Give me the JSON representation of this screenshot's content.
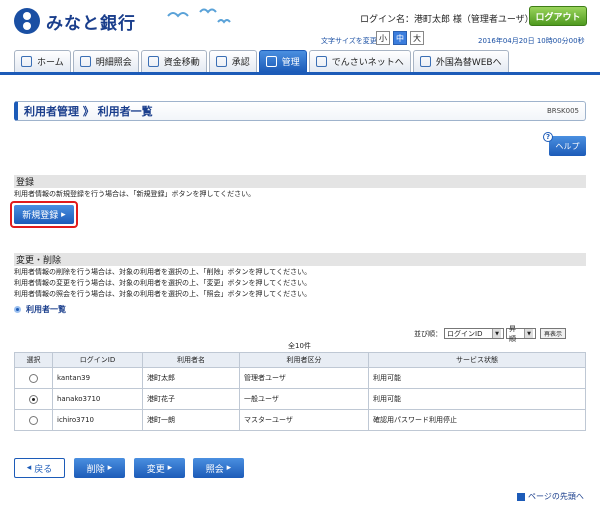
{
  "header": {
    "bank_name": "みなと銀行",
    "login_name": "ログイン名：港町太郎 様（管理者ユーザ）",
    "logout_label": "ログアウト",
    "font_size_label": "文字サイズを変更",
    "font_sizes": [
      "小",
      "中",
      "大"
    ],
    "datetime": "2016年04月20日 10時00分00秒"
  },
  "nav": {
    "tabs": [
      {
        "label": "ホーム"
      },
      {
        "label": "明細照会"
      },
      {
        "label": "資金移動"
      },
      {
        "label": "承認"
      },
      {
        "label": "管理"
      },
      {
        "label": "でんさいネットへ"
      },
      {
        "label": "外国為替WEBへ"
      }
    ]
  },
  "title": {
    "text": "利用者管理 》 利用者一覧",
    "code": "BRSK005"
  },
  "help_label": "ヘルプ",
  "register": {
    "heading": "登録",
    "description": "利用者情報の新規登録を行う場合は、「新規登録」ボタンを押してください。",
    "button_label": "新規登録"
  },
  "modify": {
    "heading": "変更・削除",
    "lines": [
      "利用者情報の削除を行う場合は、対象の利用者を選択の上、「削除」ボタンを押してください。",
      "利用者情報の変更を行う場合は、対象の利用者を選択の上、「変更」ボタンを押してください。",
      "利用者情報の照会を行う場合は、対象の利用者を選択の上、「照会」ボタンを押してください。"
    ]
  },
  "list": {
    "heading": "利用者一覧",
    "sort_label": "並び順：",
    "sort_field": "ログインID",
    "sort_order": "昇順",
    "redisplay_label": "再表示",
    "count": "全10件",
    "columns": [
      "選択",
      "ログインID",
      "利用者名",
      "利用者区分",
      "サービス状態"
    ],
    "rows": [
      {
        "selected": false,
        "login_id": "kantan39",
        "name": "港町太郎",
        "type": "管理者ユーザ",
        "status": "利用可能"
      },
      {
        "selected": true,
        "login_id": "hanako3710",
        "name": "港町花子",
        "type": "一般ユーザ",
        "status": "利用可能"
      },
      {
        "selected": false,
        "login_id": "ichiro3710",
        "name": "港町一朗",
        "type": "マスターユーザ",
        "status": "確認用パスワード利用停止"
      }
    ]
  },
  "buttons": {
    "back": "戻る",
    "delete": "削除",
    "change": "変更",
    "inquiry": "照会"
  },
  "page_top": "ページの先頭へ"
}
